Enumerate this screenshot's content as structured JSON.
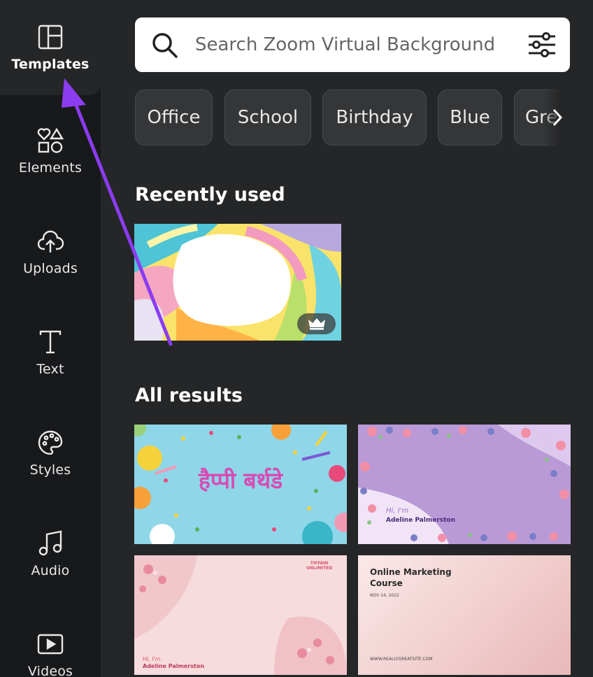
{
  "sidebar": {
    "items": [
      {
        "label": "Templates",
        "icon": "templates-icon",
        "active": true
      },
      {
        "label": "Elements",
        "icon": "elements-icon"
      },
      {
        "label": "Uploads",
        "icon": "uploads-icon"
      },
      {
        "label": "Text",
        "icon": "text-icon"
      },
      {
        "label": "Styles",
        "icon": "styles-icon"
      },
      {
        "label": "Audio",
        "icon": "audio-icon"
      },
      {
        "label": "Videos",
        "icon": "videos-icon"
      }
    ]
  },
  "search": {
    "placeholder": "Search Zoom Virtual Background",
    "value": ""
  },
  "chips": [
    "Office",
    "School",
    "Birthday",
    "Blue",
    "Gree"
  ],
  "sections": {
    "recent": "Recently used",
    "all": "All results"
  },
  "templates": {
    "t1_text": "हैप्पी बर्थडे",
    "t2_line1": "Hi, I'm",
    "t2_name": "Adeline Palmerston",
    "t3_brand1": "TIFFANI",
    "t3_brand2": "UNLIMITED",
    "t3_line1": "Hi, I'm",
    "t3_name": "Adeline Palmerston",
    "t4_title1": "Online Marketing",
    "t4_title2": "Course",
    "t4_date": "NOV 14, 2022",
    "t4_site": "WWW.REALLYGREATSITE.COM"
  },
  "colors": {
    "accent_arrow": "#8b3cf0",
    "sidebar_bg": "#18191b",
    "panel_bg": "#252627"
  }
}
